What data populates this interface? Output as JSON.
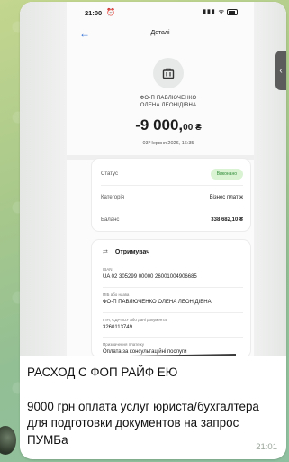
{
  "screenshot": {
    "status_time": "21:00",
    "title": "Деталі",
    "merchant_line1": "ФО-П ПАВЛЮЧЕНКО",
    "merchant_line2": "ОЛЕНА ЛЕОНІДІВНА",
    "amount_main": "-9 000,",
    "amount_cents": "00 ₴",
    "date": "03 Червня 2026, 16:35",
    "rows": [
      {
        "label": "Статус",
        "value": "Виконано"
      },
      {
        "label": "Категорія",
        "value": "Бізнес платіж"
      },
      {
        "label": "Баланс",
        "value": "338 682,10 ₴"
      }
    ],
    "recipient": {
      "heading": "Отримувач",
      "fields": [
        {
          "label": "IBAN",
          "value": "UA 02 305299 00000 26001004906685"
        },
        {
          "label": "ПІБ або назва",
          "value": "ФО-П ПАВЛЮЧЕНКО ОЛЕНА ЛЕОНІДІВНА"
        },
        {
          "label": "ІПН, ЄДРПОУ або дані документа",
          "value": "3260113749"
        },
        {
          "label": "Призначення платежу",
          "value": "Оплата за консультаційні послуги"
        }
      ]
    }
  },
  "message": {
    "line1": "РАСХОД С ФОП РАЙФ ЕЮ",
    "line2": "9000 грн оплата услуг юриста/бухгалтера для подготовки документов на запрос ПУМБа",
    "time": "21:01"
  },
  "colors": {
    "accent": "#2f6fd6",
    "status_badge_bg": "#d9f3d3",
    "status_badge_fg": "#2e8a36"
  },
  "icons": [
    "back-arrow-icon",
    "briefcase-icon",
    "swap-icon",
    "chevron-left-icon"
  ]
}
